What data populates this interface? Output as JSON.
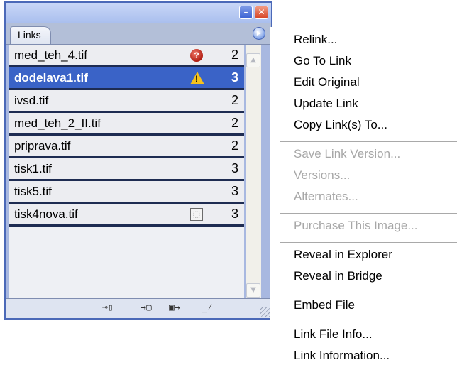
{
  "panel": {
    "tab_label": "Links",
    "title_buttons": {
      "minimize": "–",
      "close": "✕"
    },
    "menu_button_icon": "panel-menu-icon",
    "links": [
      {
        "name": "med_teh_4.tif",
        "status": "missing",
        "page": "2",
        "selected": false
      },
      {
        "name": "dodelava1.tif",
        "status": "modified",
        "page": "3",
        "selected": true
      },
      {
        "name": "ivsd.tif",
        "status": "",
        "page": "2",
        "selected": false
      },
      {
        "name": "med_teh_2_II.tif",
        "status": "",
        "page": "2",
        "selected": false
      },
      {
        "name": "priprava.tif",
        "status": "",
        "page": "2",
        "selected": false
      },
      {
        "name": "tisk1.tif",
        "status": "",
        "page": "3",
        "selected": false
      },
      {
        "name": "tisk5.tif",
        "status": "",
        "page": "3",
        "selected": false
      },
      {
        "name": "tisk4nova.tif",
        "status": "embedded",
        "page": "3",
        "selected": false
      }
    ],
    "bottom_buttons": [
      "relink-icon",
      "go-to-link-icon",
      "update-link-icon",
      "edit-original-icon"
    ]
  },
  "menu": {
    "groups": [
      [
        {
          "label": "Relink...",
          "enabled": true
        },
        {
          "label": "Go To Link",
          "enabled": true
        },
        {
          "label": "Edit Original",
          "enabled": true
        },
        {
          "label": "Update Link",
          "enabled": true
        },
        {
          "label": "Copy Link(s) To...",
          "enabled": true
        }
      ],
      [
        {
          "label": "Save Link Version...",
          "enabled": false
        },
        {
          "label": "Versions...",
          "enabled": false
        },
        {
          "label": "Alternates...",
          "enabled": false
        }
      ],
      [
        {
          "label": "Purchase This Image...",
          "enabled": false
        }
      ],
      [
        {
          "label": "Reveal in Explorer",
          "enabled": true
        },
        {
          "label": "Reveal in Bridge",
          "enabled": true
        }
      ],
      [
        {
          "label": "Embed File",
          "enabled": true
        }
      ],
      [
        {
          "label": "Link File Info...",
          "enabled": true
        },
        {
          "label": "Link Information...",
          "enabled": true
        }
      ]
    ]
  }
}
